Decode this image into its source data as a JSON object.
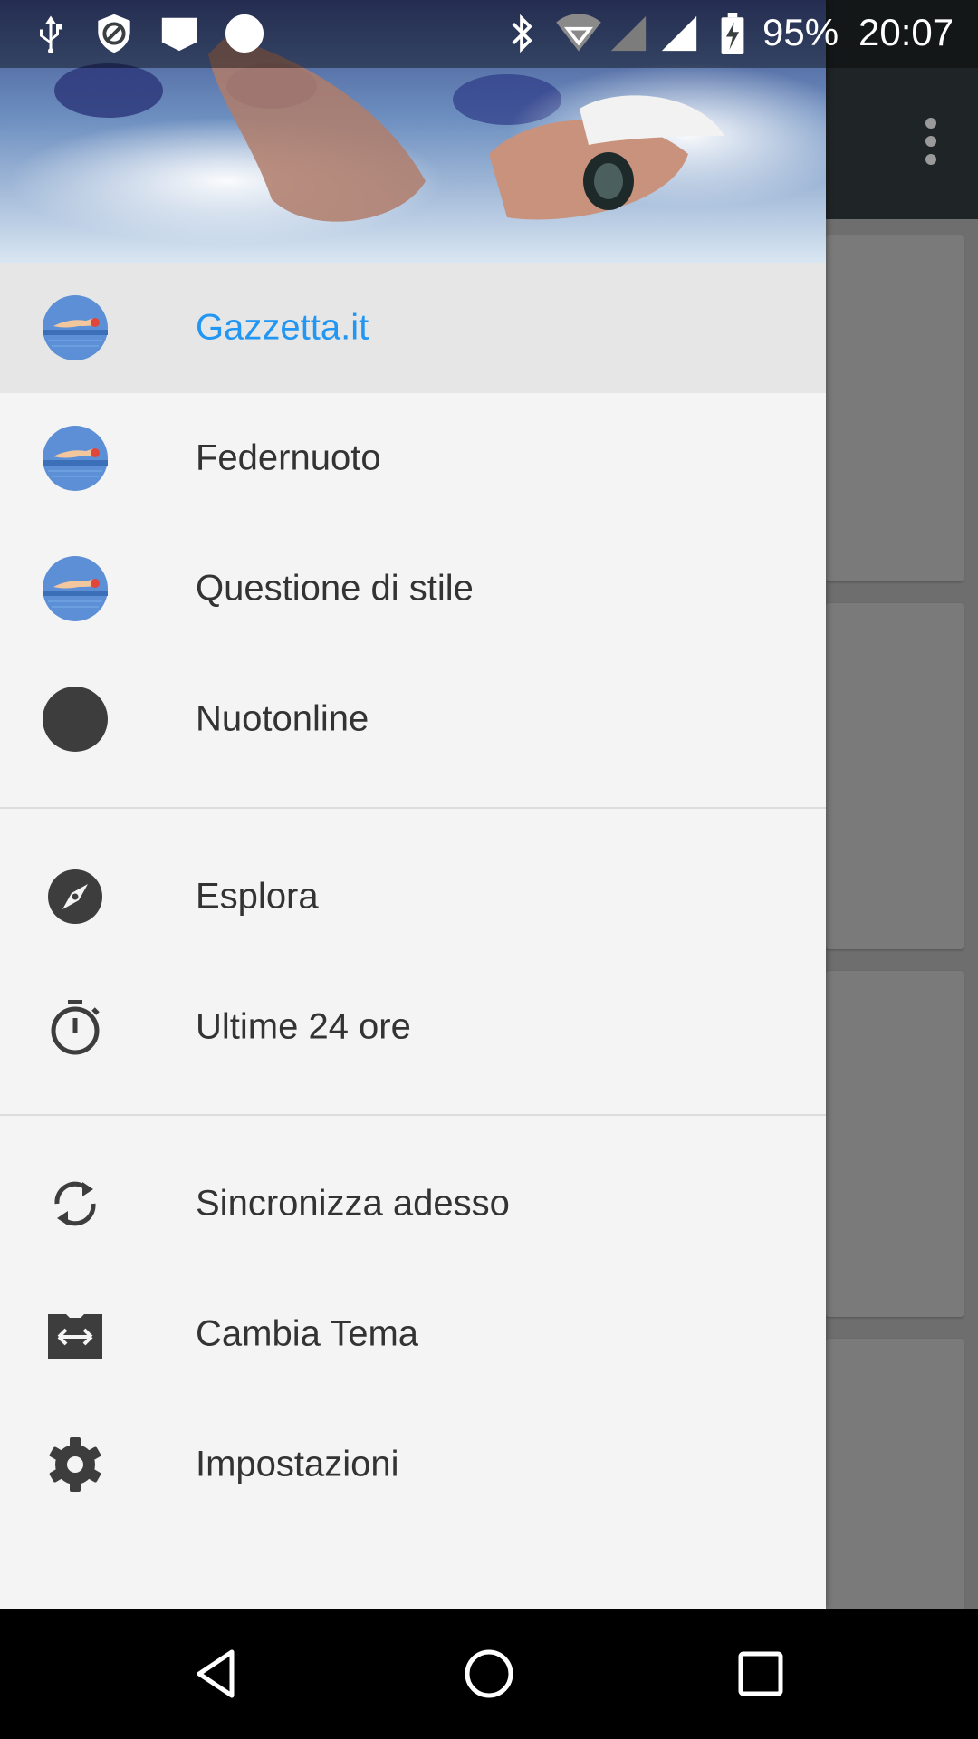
{
  "status_bar": {
    "battery_percent": "95%",
    "time": "20:07",
    "icons": [
      "usb-icon",
      "shield-icon",
      "notification-icon",
      "circle-icon",
      "bluetooth-icon",
      "wifi-icon",
      "signal-icon",
      "signal-icon",
      "battery-charging-icon"
    ]
  },
  "drawer": {
    "header_image": "swimmer-photo",
    "feeds": [
      {
        "label": "Gazzetta.it",
        "icon": "swimmer-avatar-icon",
        "active": true
      },
      {
        "label": "Federnuoto",
        "icon": "swimmer-avatar-icon",
        "active": false
      },
      {
        "label": "Questione di stile",
        "icon": "swimmer-avatar-icon",
        "active": false
      },
      {
        "label": "Nuotonline",
        "icon": "dark-circle-icon",
        "active": false
      }
    ],
    "sections": [
      {
        "label": "Esplora",
        "icon": "compass-icon"
      },
      {
        "label": "Ultime 24 ore",
        "icon": "timer-icon"
      }
    ],
    "actions": [
      {
        "label": "Sincronizza adesso",
        "icon": "sync-icon"
      },
      {
        "label": "Cambia Tema",
        "icon": "switch-theme-icon"
      },
      {
        "label": "Impostazioni",
        "icon": "gear-icon"
      }
    ]
  },
  "colors": {
    "accent": "#2196f3",
    "text": "#333333",
    "drawer_bg": "#f4f4f4"
  }
}
